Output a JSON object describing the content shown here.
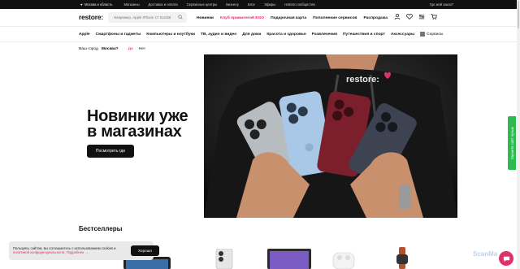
{
  "topbar": {
    "city": "Москва и область",
    "links": [
      "Магазины",
      "Доставка и оплата",
      "Сервисные центры",
      "Бизнесу",
      "Блог",
      "Эфиры",
      "restore:сообщество"
    ],
    "order_link": "Где мой заказ?"
  },
  "header": {
    "logo": "restore:",
    "search_placeholder": "Например, Apple iPhone 17 512GB",
    "nav": [
      "Новинки",
      "Клуб привилегий EGO",
      "Подарочная карта",
      "Пополнение сервисов",
      "Распродажа"
    ],
    "icons": [
      "user-icon",
      "heart-icon",
      "compare-icon",
      "cart-icon"
    ]
  },
  "catnav": {
    "items": [
      "Apple",
      "Смартфоны и гаджеты",
      "Компьютеры и ноутбуки",
      "ТВ, аудио и видео",
      "Для дома",
      "Красота и здоровье",
      "Развлечения",
      "Путешествия и спорт",
      "Аксессуары"
    ],
    "services": "Сервисы"
  },
  "city_question": {
    "text": "Ваш город",
    "city": "Москва?",
    "yes": "Да",
    "no": "Нет"
  },
  "hero": {
    "title_line1": "Новинки уже",
    "title_line2": "в магазинах",
    "button": "Посмотреть где",
    "shirt_text": "restore:"
  },
  "feedback_tab": "Оцените сайт лучше",
  "bestsellers_title": "Бестселлеры",
  "cookie": {
    "text_prefix": "Пользуясь сайтом, вы соглашаетесь с использованием cookies и",
    "link": "политикой конфиденциальности. Подробнее →",
    "button": "Хорошо"
  },
  "watermark": "ScanMa",
  "colors": {
    "accent": "#e1316b",
    "feedback": "#2dba4e",
    "dark": "#111111"
  }
}
